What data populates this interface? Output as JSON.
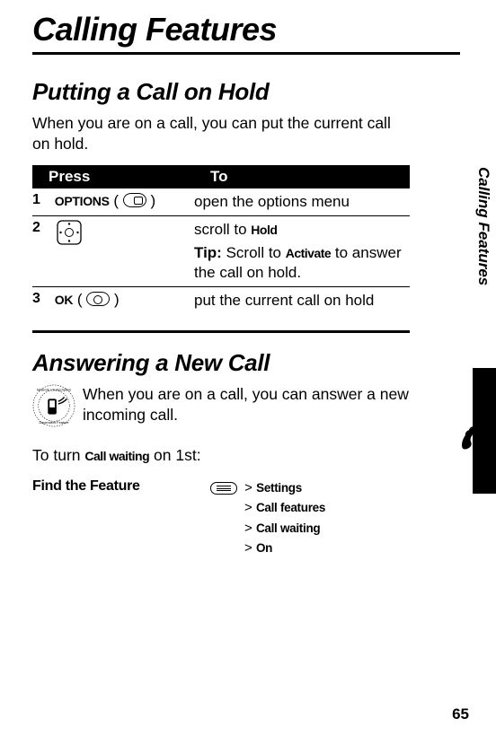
{
  "chapter_title": "Calling Features",
  "section1": {
    "title": "Putting a Call on Hold",
    "intro": "When you are on a call, you can put the current call on hold."
  },
  "table": {
    "header_press": "Press",
    "header_to": "To",
    "rows": [
      {
        "num": "1",
        "key_label": "OPTIONS",
        "desc": "open the options menu"
      },
      {
        "num": "2",
        "desc_line1_prefix": "scroll to ",
        "desc_line1_bold": "Hold",
        "tip_label": "Tip:",
        "tip_text_prefix": " Scroll to ",
        "tip_text_bold": "Activate",
        "tip_text_suffix": " to answer the call on hold."
      },
      {
        "num": "3",
        "key_label": "OK",
        "desc": "put the current call on hold"
      }
    ]
  },
  "section2": {
    "title": "Answering a New Call",
    "intro": "When you are on a call, you can answer a new incoming call.",
    "turn_on_prefix": "To turn ",
    "turn_on_bold": "Call waiting",
    "turn_on_suffix": " on 1st:"
  },
  "find_feature": {
    "label": "Find the Feature",
    "path": [
      "Settings",
      "Call features",
      "Call waiting",
      "On"
    ],
    "arrow": ">"
  },
  "side_tab": "Calling Features",
  "page_number": "65"
}
